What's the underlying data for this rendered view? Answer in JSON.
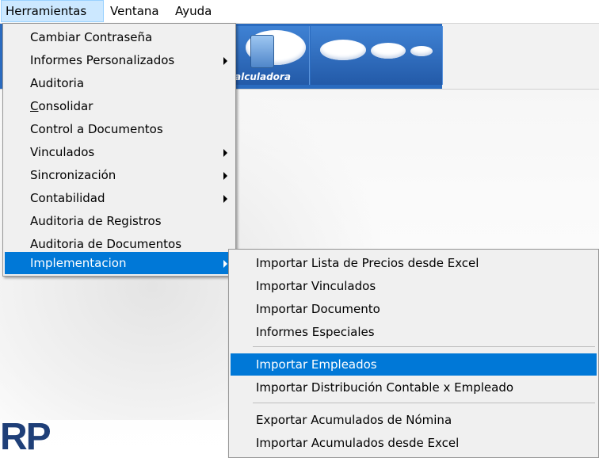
{
  "menubar": {
    "items": [
      "Herramientas",
      "Ventana",
      "Ayuda"
    ]
  },
  "toolbar": {
    "calc_label": "alculadora"
  },
  "logo": {
    "text": "RP"
  },
  "menu_herramientas": {
    "items": [
      {
        "label": "Cambiar Contraseña",
        "submenu": false
      },
      {
        "label": "Informes Personalizados",
        "submenu": true
      },
      {
        "label": "Auditoria",
        "submenu": false
      },
      {
        "label": "Consolidar",
        "submenu": false,
        "underline_first": true
      },
      {
        "label": "Control a Documentos",
        "submenu": false
      },
      {
        "label": "Vinculados",
        "submenu": true
      },
      {
        "label": "Sincronización",
        "submenu": true
      },
      {
        "label": "Contabilidad",
        "submenu": true
      },
      {
        "label": "Auditoria de Registros",
        "submenu": false
      },
      {
        "label": "Auditoria de Documentos",
        "submenu": false
      },
      {
        "label": "Implementacion",
        "submenu": true,
        "highlighted": true
      }
    ]
  },
  "menu_implementacion": {
    "items": [
      {
        "label": "Importar Lista de Precios desde Excel"
      },
      {
        "label": "Importar Vinculados"
      },
      {
        "label": "Importar Documento"
      },
      {
        "label": "Informes Especiales"
      },
      {
        "label": "Importar Empleados",
        "highlighted": true
      },
      {
        "label": "Importar Distribución Contable x Empleado"
      },
      {
        "label": "Exportar Acumulados de Nómina"
      },
      {
        "label": "Importar Acumulados desde Excel"
      }
    ]
  },
  "colors": {
    "highlight": "#0078d7",
    "menubar_active": "#cce8ff",
    "toolbar_blue": "#2a6bbf"
  }
}
